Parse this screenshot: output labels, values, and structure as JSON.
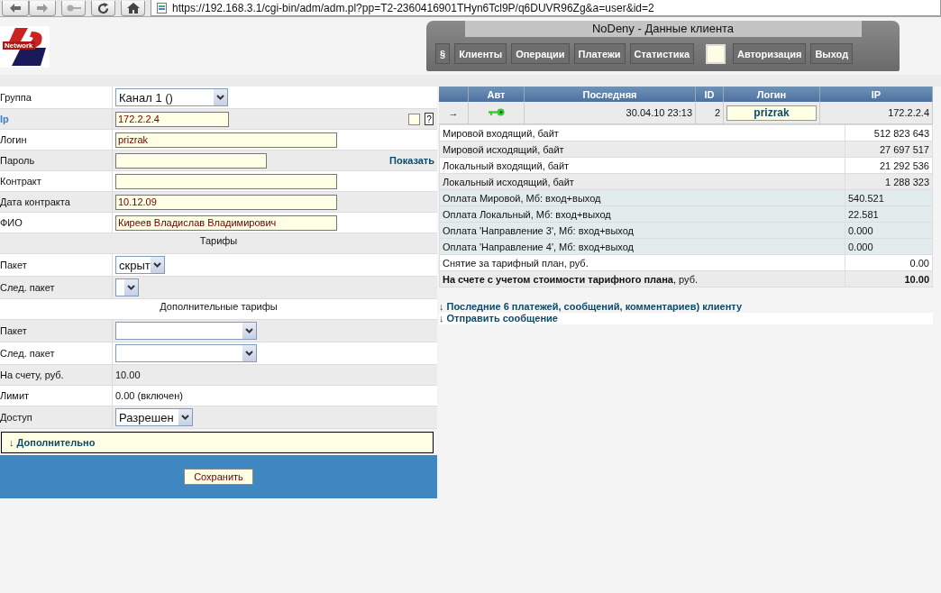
{
  "browser": {
    "url": "https://192.168.3.1/cgi-bin/adm/adm.pl?pp=T2-2360416901THyn6Tcl9P/q6DUVR96Zg&a=user&id=2"
  },
  "logo": {
    "text": "Network"
  },
  "nav": {
    "title": "NoDeny - Данные клиента",
    "items": [
      {
        "kind": "button",
        "label": "§"
      },
      {
        "kind": "button",
        "label": "Клиенты"
      },
      {
        "kind": "button",
        "label": "Операции"
      },
      {
        "kind": "button",
        "label": "Платежи"
      },
      {
        "kind": "button",
        "label": "Статистика"
      },
      {
        "kind": "blank"
      },
      {
        "kind": "button",
        "label": "Авторизация"
      },
      {
        "kind": "button",
        "label": "Выход"
      }
    ]
  },
  "form": {
    "rows": [
      {
        "kind": "select",
        "label": "Группа",
        "value": "Канал 1 ()"
      },
      {
        "kind": "ip",
        "label": "Ip",
        "value": "172.2.2.4",
        "checked": false,
        "help": "?"
      },
      {
        "kind": "input",
        "label": "Логин",
        "value": "prizrak"
      },
      {
        "kind": "password",
        "label": "Пароль",
        "value": "",
        "link": "Показать"
      },
      {
        "kind": "input",
        "label": "Контракт",
        "value": ""
      },
      {
        "kind": "input",
        "label": "Дата контракта",
        "value": "10.12.09"
      },
      {
        "kind": "input",
        "label": "ФИО",
        "value": "Киреев Владислав Владимирович"
      },
      {
        "kind": "heading",
        "label": "Тарифы"
      },
      {
        "kind": "select",
        "label": "Пакет",
        "value": "скрыт"
      },
      {
        "kind": "select",
        "label": "След. пакет",
        "value": ""
      },
      {
        "kind": "heading",
        "label": "Дополнительные тарифы"
      },
      {
        "kind": "select",
        "label": "Пакет",
        "value": ""
      },
      {
        "kind": "select",
        "label": "След. пакет",
        "value": ""
      },
      {
        "kind": "text",
        "label": "На счету, руб.",
        "value": "10.00"
      },
      {
        "kind": "text",
        "label": "Лимит",
        "value": "0.00 (включен)"
      },
      {
        "kind": "select",
        "label": "Доступ",
        "value": "Разрешен"
      }
    ],
    "more_link": "↓ Дополнительно",
    "save_button": "Сохранить"
  },
  "session": {
    "columns": [
      "",
      "Авт",
      "Последняя",
      "ID",
      "Логин",
      "IP"
    ],
    "row": {
      "arrow": "→",
      "last": "30.04.10 23:13",
      "id": "2",
      "login": "prizrak",
      "ip": "172.2.2.4"
    }
  },
  "stats": [
    {
      "kind": "traffic",
      "label": "Мировой входящий, байт",
      "value": "512 823 643"
    },
    {
      "kind": "traffic",
      "label": "Мировой исходящий, байт",
      "value": "27 697 517"
    },
    {
      "kind": "traffic",
      "label": "Локальный входящий, байт",
      "value": "21 292 536"
    },
    {
      "kind": "traffic",
      "label": "Локальный исходящий, байт",
      "value": "1 288 323"
    },
    {
      "kind": "payment",
      "label": "Оплата Мировой, Мб: вход+выход",
      "value": "540.521"
    },
    {
      "kind": "payment",
      "label": "Оплата Локальный, Мб: вход+выход",
      "value": "22.581"
    },
    {
      "kind": "payment",
      "label": "Оплата 'Направление 3', Мб: вход+выход",
      "value": "0.000"
    },
    {
      "kind": "payment",
      "label": "Оплата 'Направление 4', Мб: вход+выход",
      "value": "0.000"
    },
    {
      "kind": "traffic",
      "label": "Снятие за тарифный план, руб.",
      "value": "0.00"
    },
    {
      "kind": "total",
      "label": "**На счете с учетом стоимости тарифного плана**, руб.",
      "value": "10.00"
    }
  ],
  "links": [
    "↓ Последние 6 платежей, сообщений, комментариев) клиенту",
    "↓ Отправить сообщение"
  ]
}
